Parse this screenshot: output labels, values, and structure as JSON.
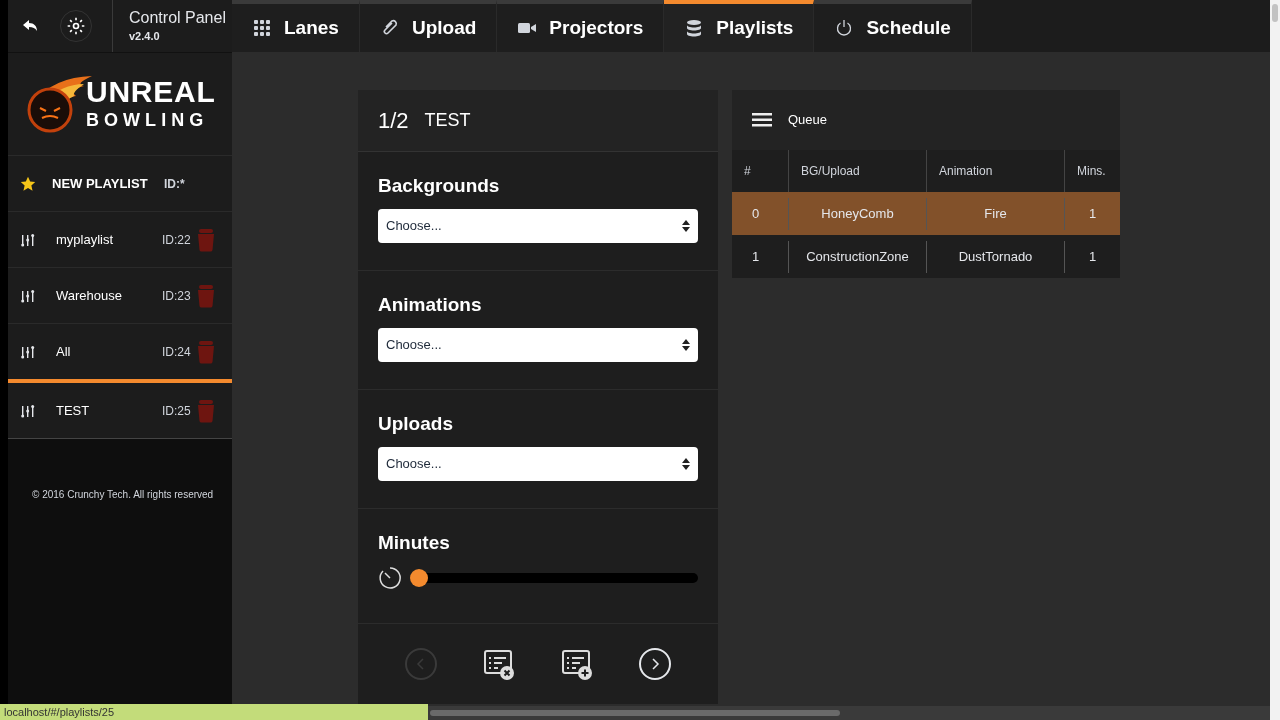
{
  "header": {
    "title": "Control Panel",
    "version": "v2.4.0"
  },
  "tabs": [
    {
      "label": "Lanes",
      "kind": "grid",
      "selected": false
    },
    {
      "label": "Upload",
      "kind": "clip",
      "selected": false
    },
    {
      "label": "Projectors",
      "kind": "camera",
      "selected": false
    },
    {
      "label": "Playlists",
      "kind": "database",
      "selected": true
    },
    {
      "label": "Schedule",
      "kind": "power",
      "selected": false
    }
  ],
  "logo": {
    "line_1": "UNREAL",
    "line_2": "BOWLING"
  },
  "new_playlist": {
    "label": "NEW PLAYLIST",
    "id": "ID:*"
  },
  "playlists": [
    {
      "name": "myplaylist",
      "id": "ID:22",
      "selected": false
    },
    {
      "name": "Warehouse",
      "id": "ID:23",
      "selected": false
    },
    {
      "name": "All",
      "id": "ID:24",
      "selected": false
    },
    {
      "name": "TEST",
      "id": "ID:25",
      "selected": true
    }
  ],
  "footer": "© 2016 Crunchy Tech. All rights reserved",
  "editor": {
    "counter": "1/2",
    "name": "TEST",
    "selects": [
      {
        "label": "Backgrounds",
        "placeholder": "Choose..."
      },
      {
        "label": "Animations",
        "placeholder": "Choose..."
      },
      {
        "label": "Uploads",
        "placeholder": "Choose..."
      }
    ],
    "minutes": {
      "label": "Minutes",
      "level": 0
    },
    "nav": {
      "previous_disabled": true,
      "next_disabled": false
    }
  },
  "queue": {
    "title": "Queue",
    "columns": [
      "#",
      "BG/Upload",
      "Animation",
      "Mins."
    ],
    "rows": [
      {
        "cells": [
          "0",
          "HoneyComb",
          "Fire",
          "1"
        ],
        "selected": true
      },
      {
        "cells": [
          "1",
          "ConstructionZone",
          "DustTornado",
          "1"
        ],
        "selected": false
      }
    ]
  },
  "status_bar": {
    "url": "localhost/#/playlists/25"
  }
}
